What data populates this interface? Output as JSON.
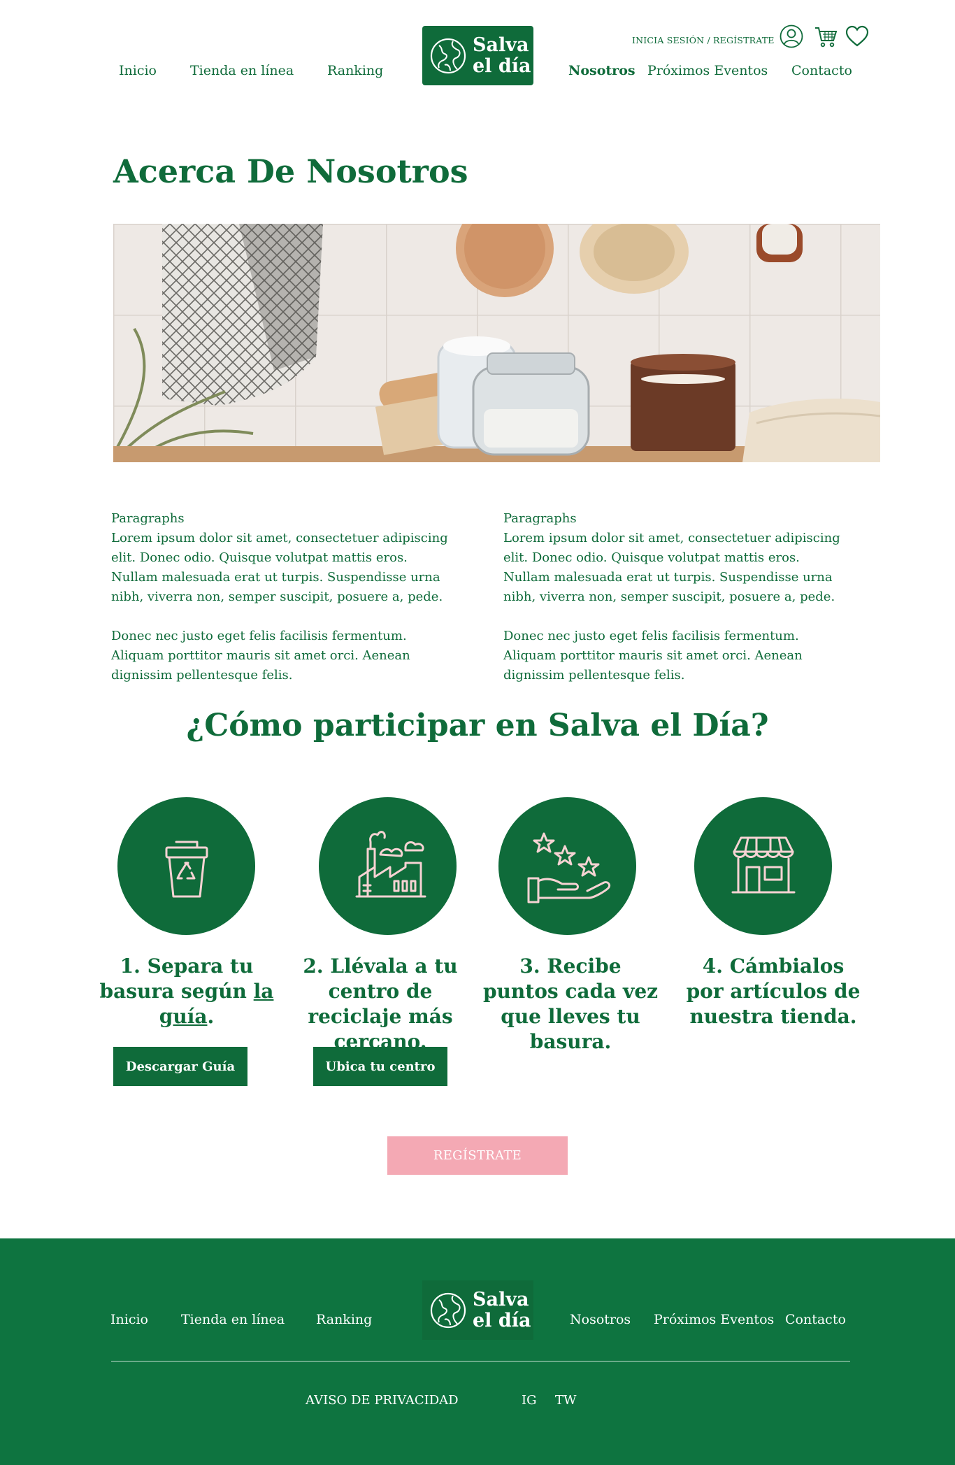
{
  "header": {
    "nav_left": [
      "Inicio",
      "Tienda en línea",
      "Ranking"
    ],
    "nav_right": [
      "Nosotros",
      "Próximos Eventos",
      "Contacto"
    ],
    "active_nav": "Nosotros",
    "logo": {
      "line1": "Salva",
      "line2": "el día"
    },
    "login_label": "INICIA SESIÓN / REGÍSTRATE",
    "icons": [
      "user-icon",
      "cart-icon",
      "heart-icon"
    ]
  },
  "main": {
    "title": "Acerca De Nosotros",
    "hero_image": "bathroom-shelf-photo",
    "columns": [
      {
        "heading": "Paragraphs",
        "p1": "Lorem ipsum dolor sit amet, consectetuer adipiscing elit. Donec odio. Quisque volutpat mattis eros. Nullam malesuada erat ut turpis. Suspendisse urna nibh, viverra non, semper suscipit, posuere a, pede.",
        "p2": "Donec nec justo eget felis facilisis fermentum. Aliquam porttitor mauris sit amet orci. Aenean dignissim pellentesque felis."
      },
      {
        "heading": "Paragraphs",
        "p1": "Lorem ipsum dolor sit amet, consectetuer adipiscing elit. Donec odio. Quisque volutpat mattis eros. Nullam malesuada erat ut turpis. Suspendisse urna nibh, viverra non, semper suscipit, posuere a, pede.",
        "p2": "Donec nec justo eget felis facilisis fermentum. Aliquam porttitor mauris sit amet orci. Aenean dignissim pellentesque felis."
      }
    ]
  },
  "participate": {
    "title": "¿Cómo participar en Salva el Día?",
    "steps": [
      {
        "icon": "recycle-bin-icon",
        "text_before": "1. Separa tu basura según ",
        "link": "la guía",
        "text_after": ".",
        "button": "Descargar Guía"
      },
      {
        "icon": "recycling-plant-icon",
        "text": "2. Llévala a tu centro de reciclaje más cercano.",
        "button": "Ubica tu centro"
      },
      {
        "icon": "hand-stars-icon",
        "text": "3. Recibe puntos cada vez que lleves tu basura."
      },
      {
        "icon": "store-icon",
        "text": "4. Cámbialos por artículos de nuestra tienda."
      }
    ],
    "register_button": "REGÍSTRATE"
  },
  "footer": {
    "nav_left": [
      "Inicio",
      "Tienda en línea",
      "Ranking"
    ],
    "nav_right": [
      "Nosotros",
      "Próximos Eventos",
      "Contacto"
    ],
    "logo": {
      "line1": "Salva",
      "line2": "el día"
    },
    "privacy": "AVISO DE PRIVACIDAD",
    "social": [
      "IG",
      "TW"
    ]
  },
  "colors": {
    "brand_green": "#0f6b3a",
    "footer_green": "#0e7440",
    "icon_pink": "#f6d3d3",
    "button_pink": "#f4a9b4"
  }
}
